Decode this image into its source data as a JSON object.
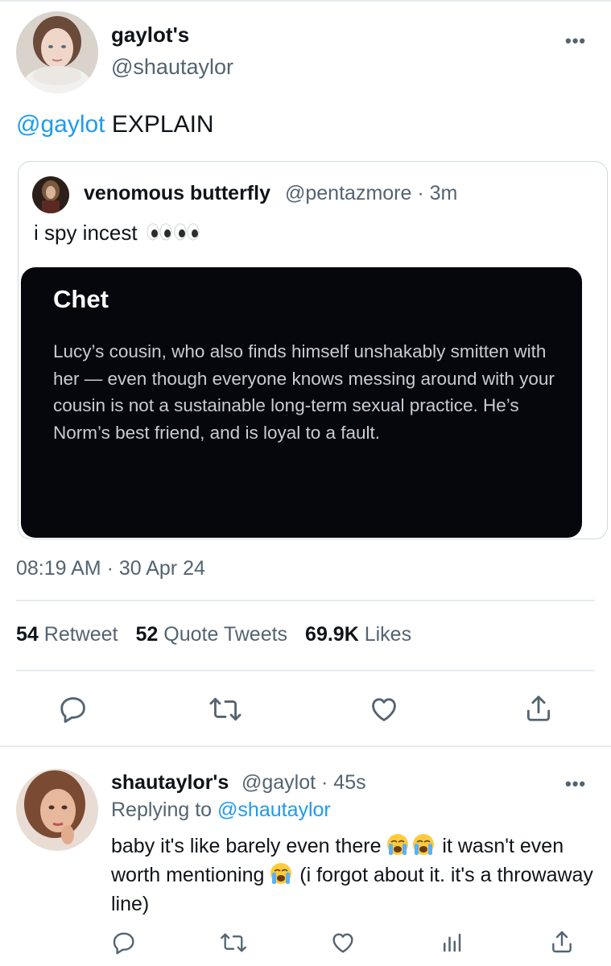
{
  "tweet": {
    "display_name": "gaylot's",
    "handle": "@shautaylor",
    "more_label": "•••",
    "text_mention": "@gaylot",
    "text_rest": " EXPLAIN",
    "timestamp": "08:19 AM · 30 Apr 24"
  },
  "quote": {
    "display_name": "venomous butterfly",
    "meta": "@pentazmore · 3m",
    "text": "i spy incest ",
    "emoji": "eyes",
    "image": {
      "title": "Chet",
      "body": "Lucy’s cousin, who also finds himself unshakably smitten with her — even though everyone knows messing around with your cousin is not a sustainable long-term sexual practice. He’s Norm’s best friend, and is loyal to a fault."
    }
  },
  "stats": {
    "retweets_count": "54",
    "retweets_label": "Retweet",
    "quotes_count": "52",
    "quotes_label": "Quote Tweets",
    "likes_count": "69.9K",
    "likes_label": "Likes"
  },
  "actions": [
    "reply-icon",
    "retweet-icon",
    "like-icon",
    "share-icon"
  ],
  "reply": {
    "display_name": "shautaylor's",
    "meta": "@gaylot · 45s",
    "replying_prefix": "Replying to ",
    "replying_to": "@shautaylor",
    "text_1": "baby it's like barely even there ",
    "text_2": " it wasn't even worth mentioning ",
    "text_3": " (i forgot about it. it's a throwaway line)",
    "emoji": "loudly-crying-face",
    "more_label": "•••",
    "actions": [
      "reply-icon",
      "retweet-icon",
      "like-icon",
      "analytics-icon",
      "share-icon"
    ]
  },
  "colors": {
    "accent": "#1d9bf0",
    "secondary_text": "#536471",
    "border": "#e6ecf0",
    "image_bg": "#05070d"
  }
}
